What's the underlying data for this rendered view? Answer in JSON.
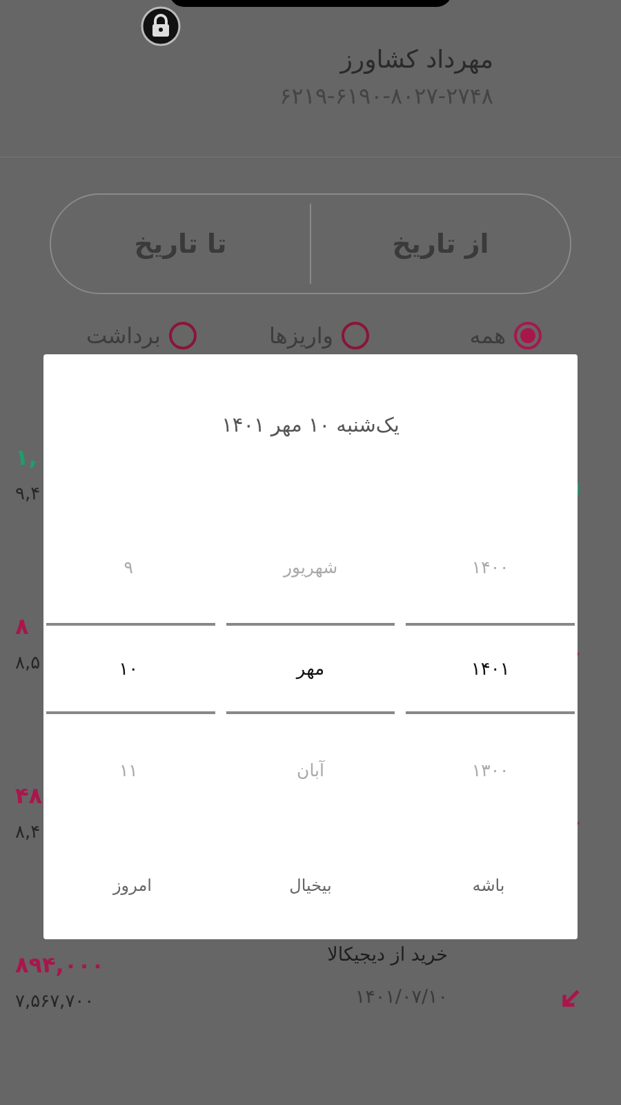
{
  "header": {
    "name": "مهرداد کشاورز",
    "card_number": "۶۲۱۹-۶۱۹۰-۸۰۲۷-۲۷۴۸"
  },
  "date_range": {
    "from": "از تاریخ",
    "to": "تا تاریخ"
  },
  "filters": [
    {
      "label": "همه",
      "selected": true
    },
    {
      "label": "واریزها",
      "selected": false
    },
    {
      "label": "برداشت",
      "selected": false
    }
  ],
  "transactions": [
    {
      "kind": "deposit",
      "amount": "۱,",
      "balance": "۹,۴"
    },
    {
      "kind": "withdrawal",
      "amount": "۸",
      "balance": "۸,۵"
    },
    {
      "kind": "withdrawal",
      "amount": "۴۸",
      "balance": "۸,۴"
    },
    {
      "kind": "withdrawal",
      "title": "خرید از دیجیکالا",
      "date": "۱۴۰۱/۰۷/۱۰",
      "amount": "۸۹۴,۰۰۰",
      "balance": "۷,۵۶۷,۷۰۰"
    }
  ],
  "dialog": {
    "title": "یک‌شنبه ۱۰ مهر ۱۴۰۱",
    "columns": [
      {
        "kind": "year",
        "options": [
          {
            "label": "۱۴۰۰",
            "selected": false
          },
          {
            "label": "۱۴۰۱",
            "selected": true
          },
          {
            "label": "۱۳۰۰",
            "selected": false
          }
        ]
      },
      {
        "kind": "month",
        "options": [
          {
            "label": "شهریور",
            "selected": false
          },
          {
            "label": "مهر",
            "selected": true
          },
          {
            "label": "آبان",
            "selected": false
          }
        ]
      },
      {
        "kind": "day",
        "options": [
          {
            "label": "۹",
            "selected": false
          },
          {
            "label": "۱۰",
            "selected": true
          },
          {
            "label": "۱۱",
            "selected": false
          }
        ]
      }
    ],
    "buttons": [
      "باشه",
      "بیخیال",
      "امروز"
    ]
  }
}
